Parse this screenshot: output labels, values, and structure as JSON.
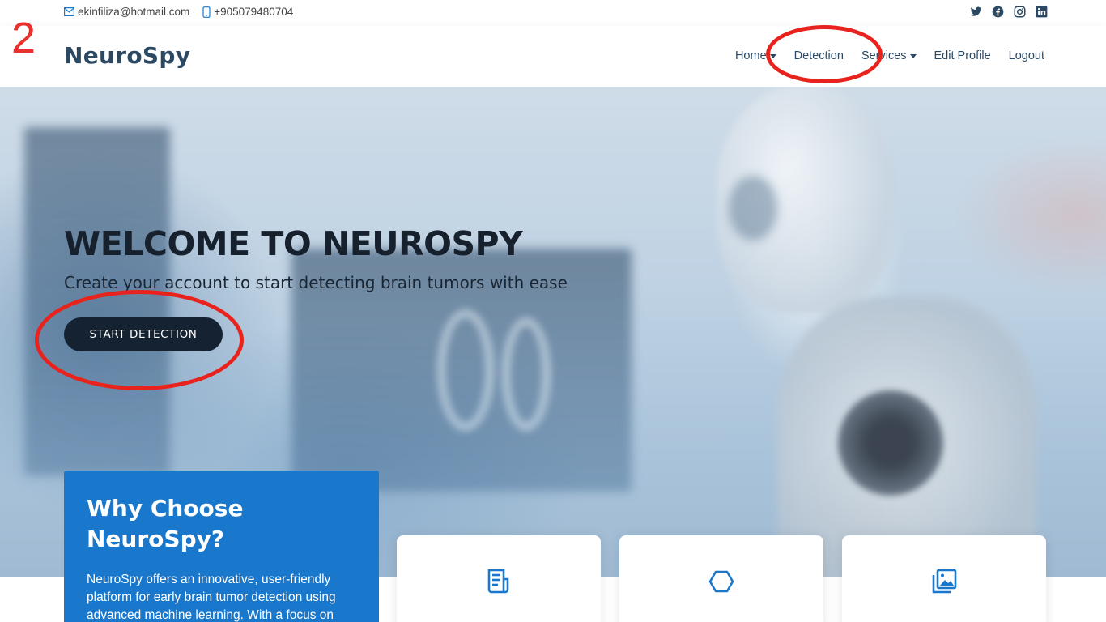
{
  "topbar": {
    "email": "ekinfiliza@hotmail.com",
    "phone": "+905079480704",
    "social_icons": [
      "twitter-icon",
      "facebook-icon",
      "instagram-icon",
      "linkedin-icon"
    ]
  },
  "header": {
    "logo": "NeuroSpy",
    "nav": [
      {
        "label": "Home",
        "dropdown": true
      },
      {
        "label": "Detection",
        "dropdown": false
      },
      {
        "label": "Services",
        "dropdown": true
      },
      {
        "label": "Edit Profile",
        "dropdown": false
      },
      {
        "label": "Logout",
        "dropdown": false
      }
    ]
  },
  "annotation": {
    "step_number": "2",
    "color": "#e8231e"
  },
  "hero": {
    "title": "WELCOME TO NEUROSPY",
    "subtitle": "Create your account to start detecting brain tumors with ease",
    "cta_label": "START DETECTION"
  },
  "why": {
    "title": "Why Choose NeuroSpy?",
    "text": "NeuroSpy offers an innovative, user-friendly platform for early brain tumor detection using advanced machine learning. With a focus on"
  },
  "cards": [
    {
      "icon": "document-icon"
    },
    {
      "icon": "cube-icon"
    },
    {
      "icon": "images-icon"
    }
  ],
  "colors": {
    "primary": "#1977cc",
    "heading": "#2c4964",
    "cta": "#142232"
  }
}
